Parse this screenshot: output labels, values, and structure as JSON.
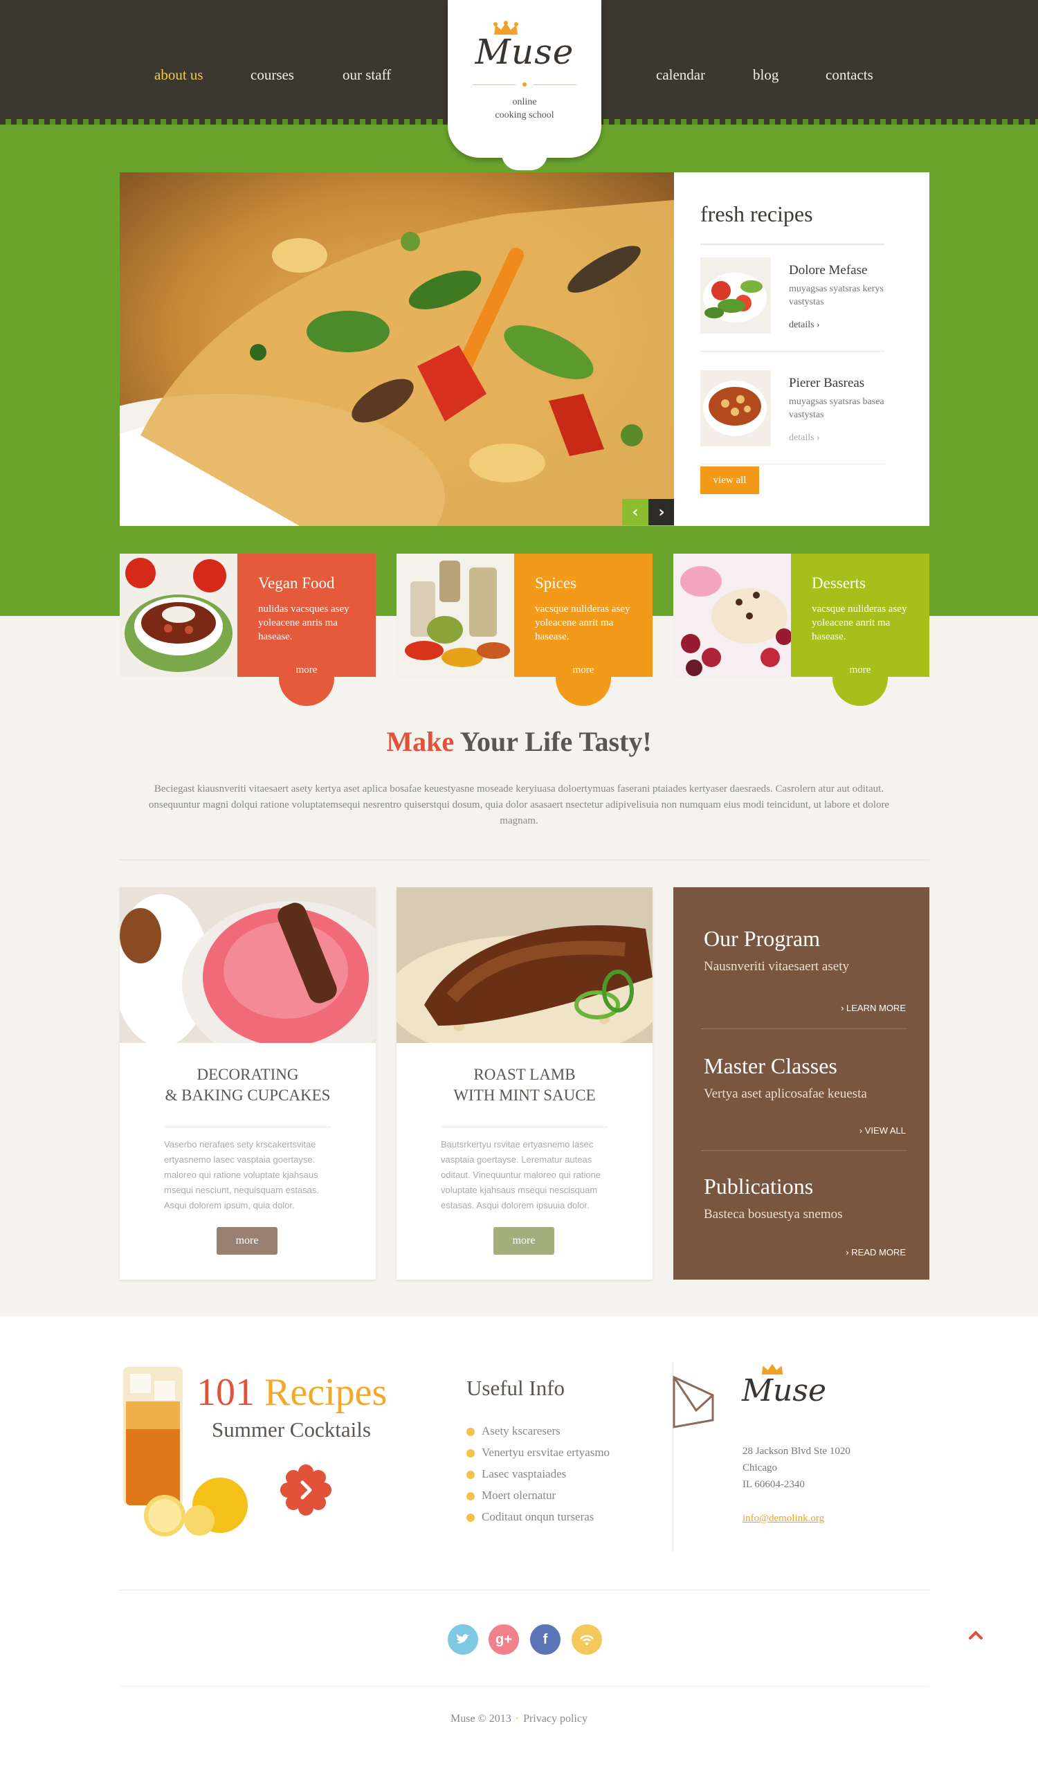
{
  "nav": {
    "left": [
      {
        "label": "about us",
        "active": true
      },
      {
        "label": "courses",
        "active": false
      },
      {
        "label": "our staff",
        "active": false
      }
    ],
    "right": [
      {
        "label": "calendar"
      },
      {
        "label": "blog"
      },
      {
        "label": "contacts"
      }
    ]
  },
  "logo": {
    "name": "Muse",
    "tagline_line1": "online",
    "tagline_line2": "cooking school"
  },
  "hero": {
    "image": "pasta-dish-photo",
    "prev_icon": "chevron-left-icon",
    "next_icon": "chevron-right-icon"
  },
  "fresh_recipes": {
    "title": "fresh recipes",
    "items": [
      {
        "name": "Dolore Mefase",
        "desc": "muyagsas syatsras kerys vastystas",
        "details": "details",
        "image": "salad-photo"
      },
      {
        "name": "Pierer Basreas",
        "desc": "muyagsas syatsras basea vastystas",
        "details": "details",
        "image": "soup-photo"
      }
    ],
    "view_all": "view all"
  },
  "categories": [
    {
      "title": "Vegan Food",
      "desc": "nulidas vacsques asey yoleacene anris ma hasease.",
      "more": "more",
      "color": "#e55a3b",
      "image": "chili-bowl-photo"
    },
    {
      "title": "Spices",
      "desc": "vacsque nulideras asey yoleacene anrit ma hasease.",
      "more": "more",
      "color": "#f39a1a",
      "image": "spice-jars-photo"
    },
    {
      "title": "Desserts",
      "desc": "vacsque nulideras asey yoleacene anrit ma hasease.",
      "more": "more",
      "color": "#a6bf1a",
      "image": "dessert-berries-photo"
    }
  ],
  "intro": {
    "title_accent": "Make",
    "title_rest": " Your Life Tasty!",
    "text": "Beciegast kiausnveriti vitaesaert asety kertya aset aplica bosafae keuestyasne moseade keryiuasa doloertymuas faserani ptaiades kertyaser daesraeds. Casrolern atur aut oditaut. onsequuntur magni dolqui ratione voluptatemsequi nesrentro quiserstqui dosum, quia dolor asasaert nsectetur adipivelisuia non numquam eius modi teincidunt, ut labore et dolore magnam."
  },
  "features": [
    {
      "title_line1": "DECORATING",
      "title_line2": "& BAKING CUPCAKES",
      "text": "Vaserbo nerafaes sety krscakertsvitae ertyasnemo lasec vasptaia goertayse. maloreo qui ratione voluptate kjahsaus msequi nesciunt, nequisquam estasas. Asqui dolorem ipsum, quia dolor.",
      "button": "more",
      "button_color": "#9a8070",
      "image": "cupcake-photo"
    },
    {
      "title_line1": "ROAST LAMB",
      "title_line2": "WITH MINT SAUCE",
      "text": "Bautsrkertyu rsvitae ertyasnemo lasec vasptaia goertayse. Lerematur auteas oditaut. Vinequuntur maloreo qui ratione voluptate kjahsaus msequi nescisquam estasas. Asqui dolorem ipsuuia dolor.",
      "button": "more",
      "button_color": "#a3ae7e",
      "image": "roast-lamb-photo"
    }
  ],
  "program": {
    "items": [
      {
        "title": "Our Program",
        "sub": "Nausnveriti vitaesaert asety",
        "link": "LEARN MORE"
      },
      {
        "title": "Master Classes",
        "sub": "Vertya aset aplicosafae keuesta",
        "link": "VIEW ALL"
      },
      {
        "title": "Publications",
        "sub": "Basteca bosuestya snemos",
        "link": "READ MORE"
      }
    ]
  },
  "promo": {
    "number": "101",
    "word": " Recipes",
    "sub": "Summer Cocktails",
    "button_icon": "arrow-right-icon",
    "image": "cocktail-lemons-photo"
  },
  "useful_info": {
    "title": "Useful Info",
    "items": [
      "Asety kscaresers",
      "Venertyu ersvitae ertyasmo",
      "Lasec vasptaiades",
      "Moert olernatur",
      "Coditaut onqun turseras"
    ]
  },
  "contact": {
    "logo": "Muse",
    "address_line1": "28 Jackson Blvd Ste 1020",
    "address_line2": "Chicago",
    "address_line3": "IL 60604-2340",
    "email": "info@demolink.org"
  },
  "social": [
    {
      "name": "twitter",
      "icon": "twitter-icon",
      "color": "#7ec8e3"
    },
    {
      "name": "google-plus",
      "icon": "google-plus-icon",
      "color": "#f0808a",
      "glyph": "g+"
    },
    {
      "name": "facebook",
      "icon": "facebook-icon",
      "color": "#5b74b8",
      "glyph": "f"
    },
    {
      "name": "rss",
      "icon": "rss-icon",
      "color": "#f5c85c"
    }
  ],
  "footer": {
    "copyright": "Muse © 2013",
    "separator": "·",
    "privacy": "Privacy policy"
  }
}
